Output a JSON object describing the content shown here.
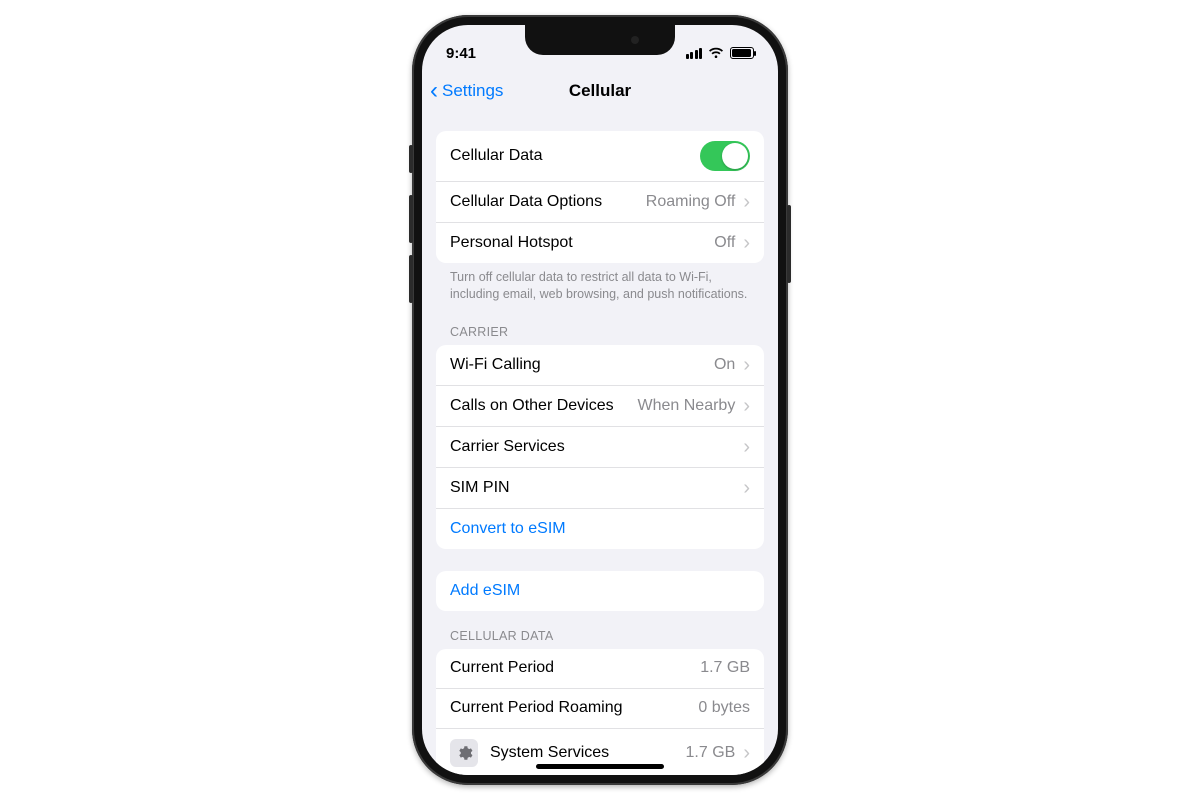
{
  "status": {
    "time": "9:41"
  },
  "nav": {
    "back": "Settings",
    "title": "Cellular"
  },
  "group1": {
    "cellular_data": {
      "label": "Cellular Data",
      "on": true
    },
    "cellular_data_options": {
      "label": "Cellular Data Options",
      "value": "Roaming Off"
    },
    "personal_hotspot": {
      "label": "Personal Hotspot",
      "value": "Off"
    },
    "footer": "Turn off cellular data to restrict all data to Wi-Fi, including email, web browsing, and push notifications."
  },
  "carrier": {
    "header": "CARRIER",
    "wifi_calling": {
      "label": "Wi-Fi Calling",
      "value": "On"
    },
    "calls_other": {
      "label": "Calls on Other Devices",
      "value": "When Nearby"
    },
    "carrier_services": {
      "label": "Carrier Services"
    },
    "sim_pin": {
      "label": "SIM PIN"
    },
    "convert_esim": {
      "label": "Convert to eSIM"
    }
  },
  "add_esim": {
    "label": "Add eSIM"
  },
  "usage": {
    "header": "CELLULAR DATA",
    "current_period": {
      "label": "Current Period",
      "value": "1.7 GB"
    },
    "current_period_roaming": {
      "label": "Current Period Roaming",
      "value": "0 bytes"
    },
    "system_services": {
      "label": "System Services",
      "value": "1.7 GB"
    }
  }
}
